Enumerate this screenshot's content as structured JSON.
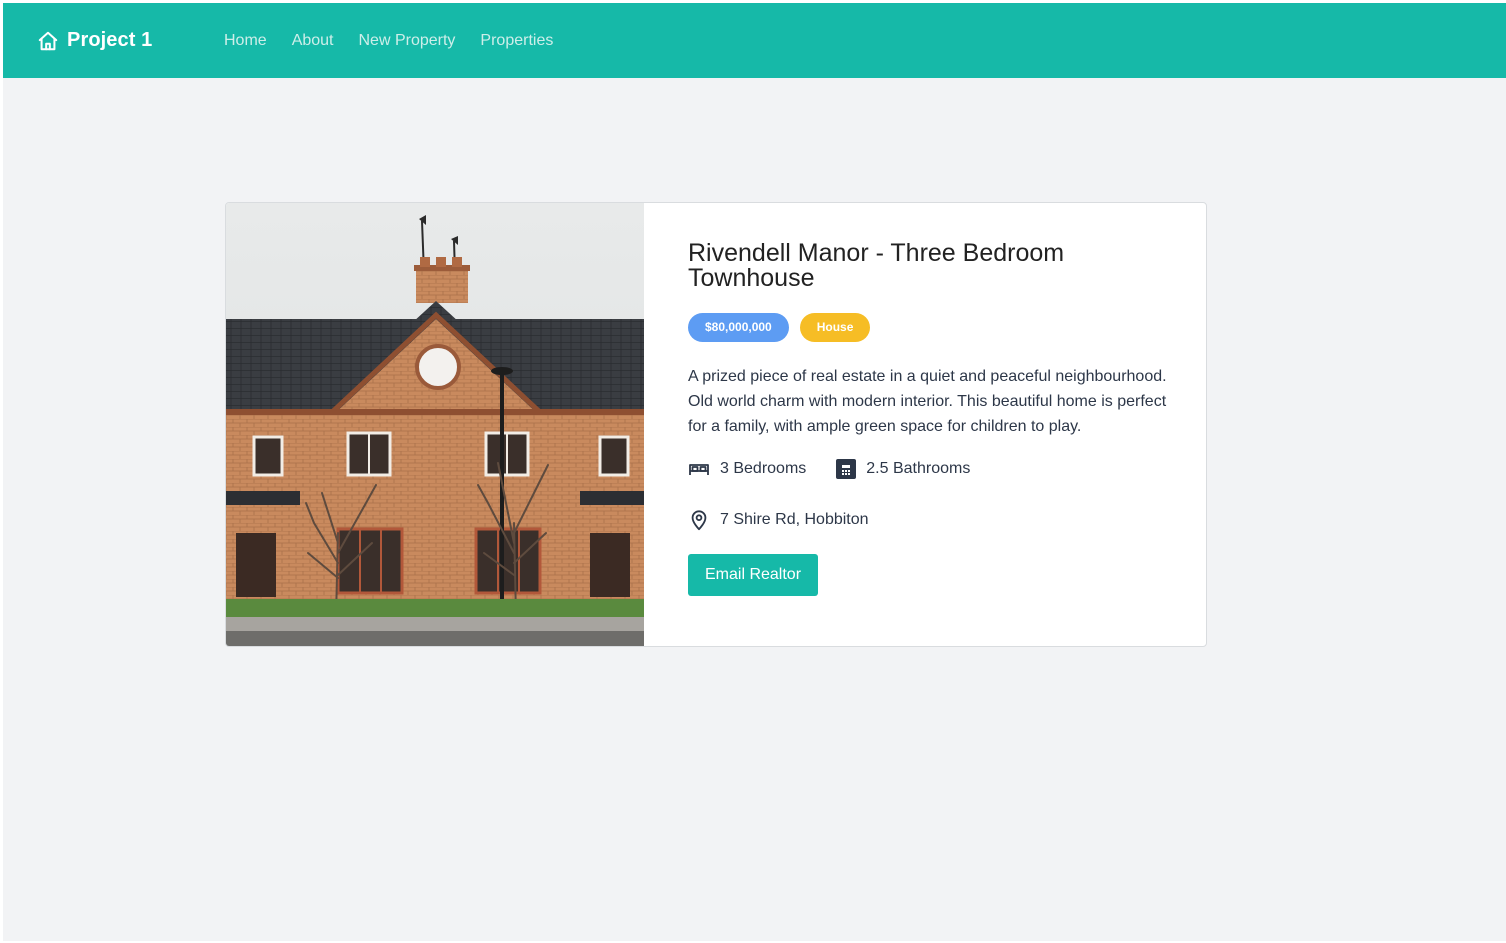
{
  "brand": {
    "name": "Project 1",
    "icon": "home-icon"
  },
  "nav": {
    "links": [
      "Home",
      "About",
      "New Property",
      "Properties"
    ]
  },
  "colors": {
    "accent": "#16b9a8",
    "price_badge": "#5d9cf3",
    "type_badge": "#f6bd25",
    "page_bg": "#f2f3f5"
  },
  "property": {
    "title": "Rivendell Manor - Three Bedroom Townhouse",
    "price": "$80,000,000",
    "type": "House",
    "description": "A prized piece of real estate in a quiet and peaceful neighbourhood.  Old world charm with modern interior. This beautiful home is perfect for a family, with ample green space for children to play.",
    "bedrooms": "3 Bedrooms",
    "bathrooms": "2.5 Bathrooms",
    "address": "7 Shire Rd, Hobbiton",
    "photo_icon": "brick-townhouse-photo",
    "icons": {
      "bedrooms": "bed-icon",
      "bathrooms": "bathroom-icon",
      "address": "map-pin-icon"
    }
  },
  "cta": {
    "label": "Email Realtor"
  }
}
